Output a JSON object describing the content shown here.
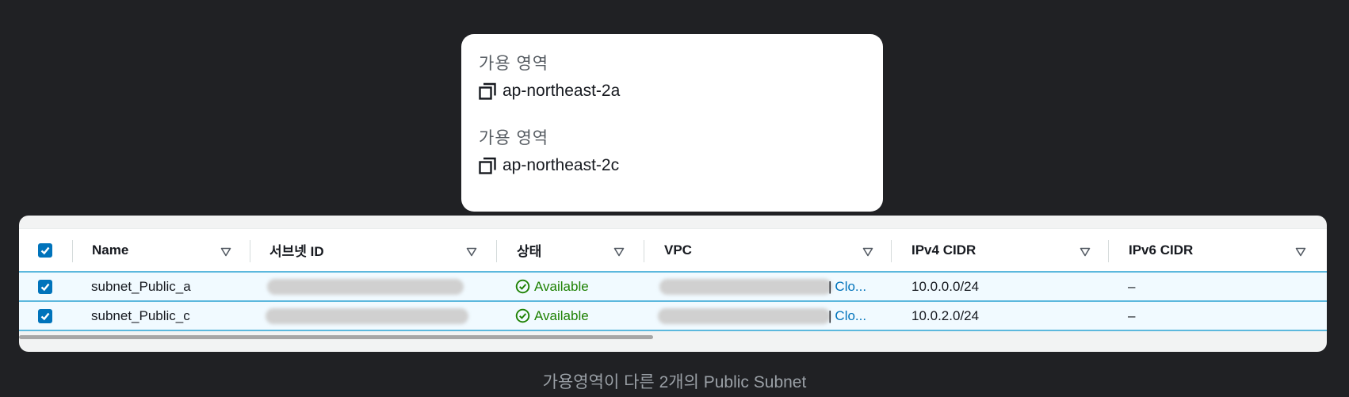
{
  "availability_zone_card": {
    "items": [
      {
        "label": "가용 영역",
        "value": "ap-northeast-2a"
      },
      {
        "label": "가용 영역",
        "value": "ap-northeast-2c"
      }
    ]
  },
  "subnet_table": {
    "columns": [
      {
        "label": "Name"
      },
      {
        "label": "서브넷 ID"
      },
      {
        "label": "상태"
      },
      {
        "label": "VPC"
      },
      {
        "label": "IPv4 CIDR"
      },
      {
        "label": "IPv6 CIDR"
      }
    ],
    "rows": [
      {
        "name": "subnet_Public_a",
        "status": "Available",
        "vpc_suffix": "Clo...",
        "ipv4_cidr": "10.0.0.0/24",
        "ipv6_cidr": "–",
        "checked": true
      },
      {
        "name": "subnet_Public_c",
        "status": "Available",
        "vpc_suffix": "Clo...",
        "ipv4_cidr": "10.0.2.0/24",
        "ipv6_cidr": "–",
        "checked": true
      }
    ],
    "select_all_checked": true,
    "vpc_separator": "|"
  },
  "caption": "가용영역이 다른 2개의 Public Subnet",
  "colors": {
    "background": "#202124",
    "accent": "#0073bb",
    "status_available": "#1d8102",
    "row_selected": "#f1faff",
    "row_border": "#5cb8dd"
  },
  "icons": {
    "copy": "copy-icon",
    "sort": "sort-triangle-icon",
    "status": "check-circle-icon",
    "checkbox": "checkbox-checked-icon"
  }
}
